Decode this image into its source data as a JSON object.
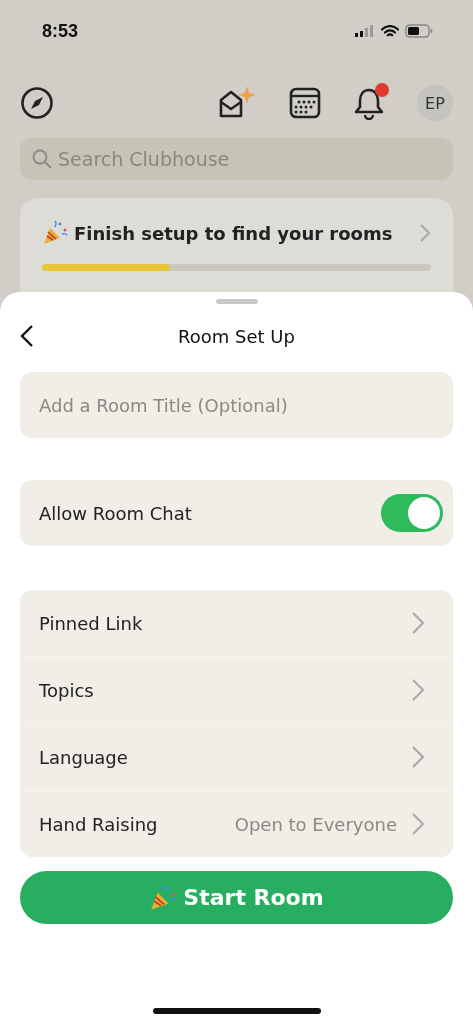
{
  "status_bar": {
    "time": "8:53"
  },
  "header": {
    "has_notification": true,
    "avatar_initials": "EP"
  },
  "search": {
    "placeholder": "Search Clubhouse"
  },
  "setup_card": {
    "title": "Finish setup to find your rooms",
    "level": 0.33
  },
  "sheet": {
    "title": "Room Set Up",
    "room_title": {
      "placeholder": "Add a Room Title (Optional)"
    },
    "room_chat": {
      "label": "Allow Room Chat",
      "on": true
    },
    "options": [
      {
        "label": "Pinned Link"
      },
      {
        "label": "Topics"
      },
      {
        "label": "Language"
      },
      {
        "label": "Hand Raising",
        "value": "Open to Everyone"
      }
    ],
    "start_button": "Start Room"
  }
}
